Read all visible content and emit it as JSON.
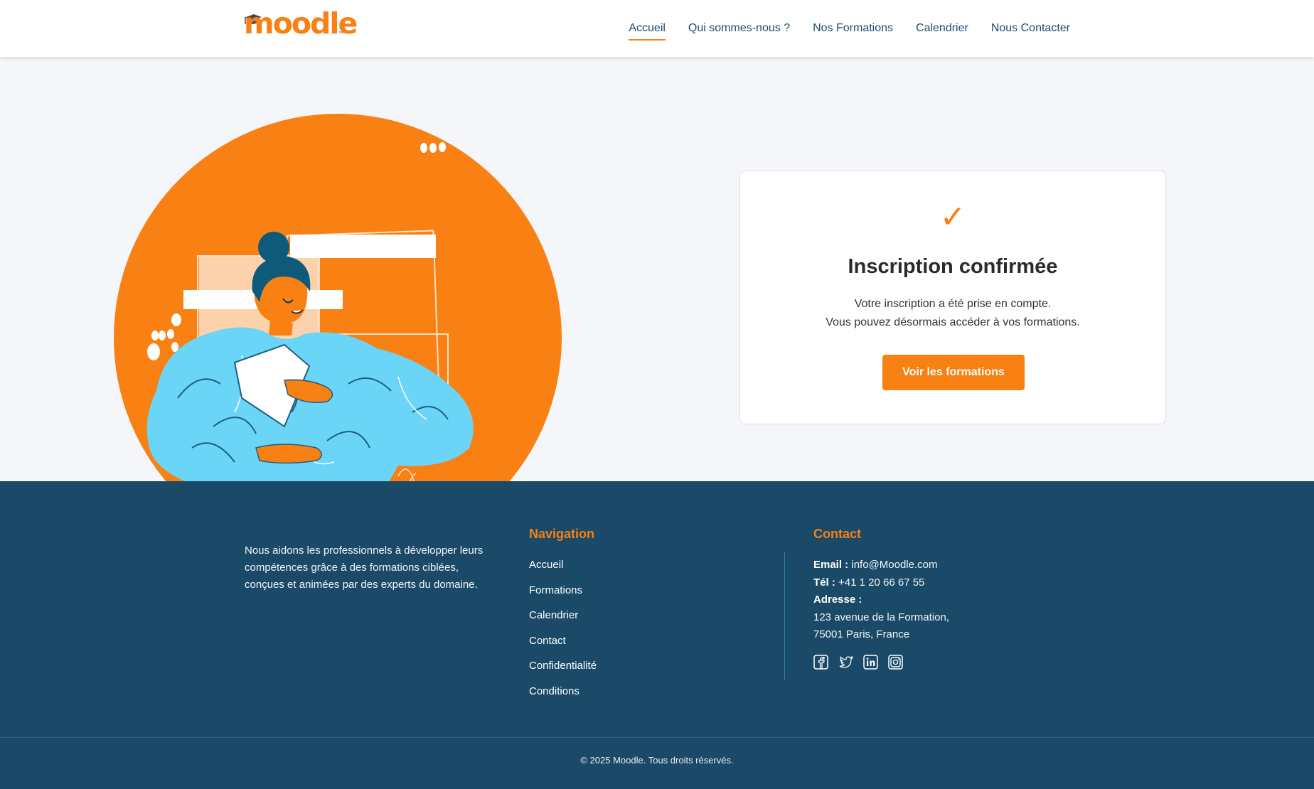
{
  "header": {
    "logo_text": "moodle",
    "logo_tm": "™",
    "nav": [
      {
        "label": "Accueil",
        "active": true
      },
      {
        "label": "Qui sommes-nous ?"
      },
      {
        "label": "Nos Formations"
      },
      {
        "label": "Calendrier"
      },
      {
        "label": "Nous Contacter"
      }
    ]
  },
  "confirmation": {
    "check_glyph": "✓",
    "title": "Inscription confirmée",
    "line1": "Votre inscription a été prise en compte.",
    "line2": "Vous pouvez désormais accéder à vos formations.",
    "button_label": "Voir les formations"
  },
  "footer": {
    "about": "Nous aidons les professionnels à développer leurs compétences grâce à des formations ciblées, conçues et animées par des experts du domaine.",
    "navigation_title": "Navigation",
    "navigation_links": [
      "Accueil",
      "Formations",
      "Calendrier",
      "Contact",
      "Confidentialité",
      "Conditions"
    ],
    "contact_title": "Contact",
    "email_label": "Email :",
    "email": "info@Moodle.com",
    "phone_label": "Tél :",
    "phone": "+41 1 20 66 67 55",
    "address_label": "Adresse :",
    "address_line1": "123 avenue de la Formation,",
    "address_line2": "75001 Paris, France",
    "socials": [
      "facebook-icon",
      "twitter-icon",
      "linkedin-icon",
      "instagram-icon"
    ],
    "copyright": "© 2025 Moodle. Tous droits réservés."
  },
  "colors": {
    "accent": "#f98012",
    "footer_bg": "#1b4a69",
    "nav_text": "#1e4c6a",
    "illustration_sweater": "#6bd5f8",
    "illustration_hair": "#0e5a7a"
  }
}
